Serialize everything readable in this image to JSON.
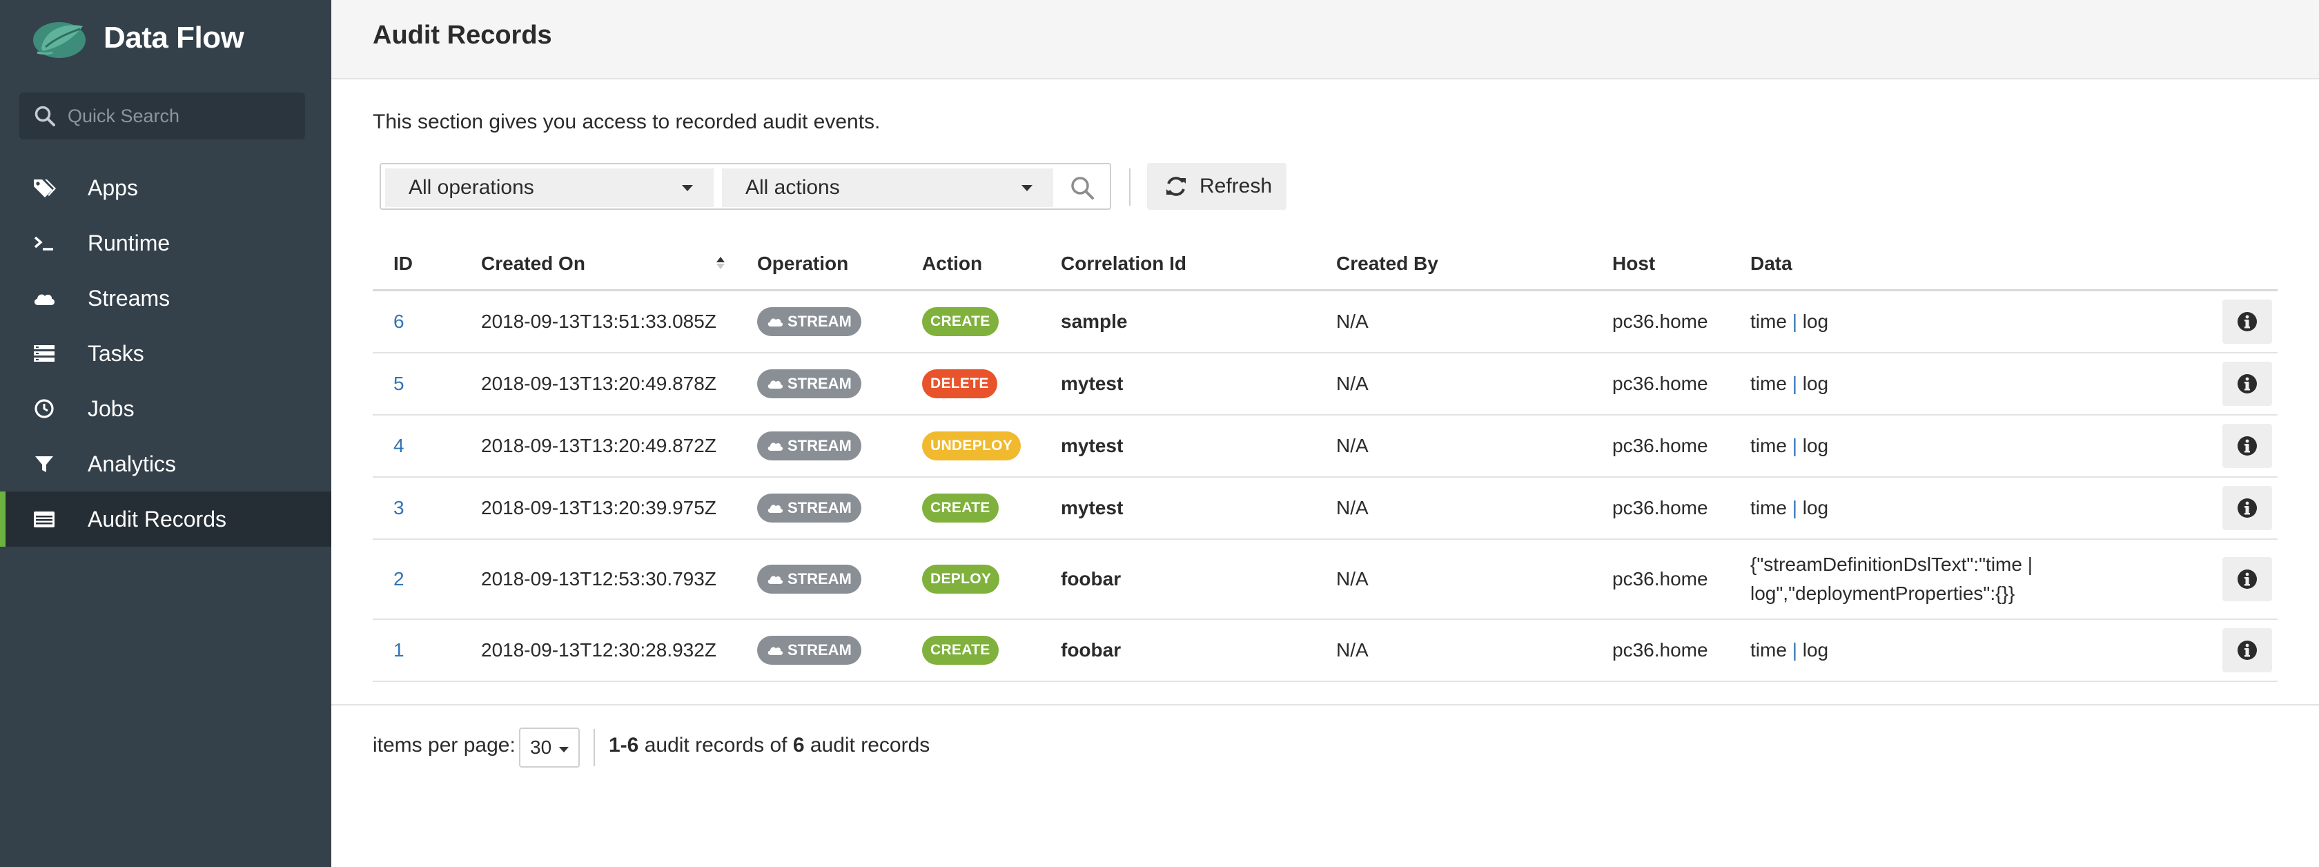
{
  "app": {
    "title": "Data Flow",
    "logo_icon": "spring-leaf-logo"
  },
  "sidebar": {
    "search_placeholder": "Quick Search",
    "items": [
      {
        "label": "Apps",
        "icon": "tags-icon",
        "active": false
      },
      {
        "label": "Runtime",
        "icon": "terminal-icon",
        "active": false
      },
      {
        "label": "Streams",
        "icon": "cloud-icon",
        "active": false
      },
      {
        "label": "Tasks",
        "icon": "tasks-list-icon",
        "active": false
      },
      {
        "label": "Jobs",
        "icon": "clock-icon",
        "active": false
      },
      {
        "label": "Analytics",
        "icon": "filter-icon",
        "active": false
      },
      {
        "label": "Audit Records",
        "icon": "audit-table-icon",
        "active": true
      }
    ]
  },
  "header": {
    "title": "Audit Records"
  },
  "intro": "This section gives you access to recorded audit events.",
  "filters": {
    "operations_value": "All operations",
    "actions_value": "All actions",
    "refresh_label": "Refresh"
  },
  "table": {
    "columns": [
      "ID",
      "Created On",
      "Operation",
      "Action",
      "Correlation Id",
      "Created By",
      "Host",
      "Data"
    ],
    "rows": [
      {
        "id": "6",
        "created_on": "2018-09-13T13:51:33.085Z",
        "operation": "STREAM",
        "action": "CREATE",
        "correlation_id": "sample",
        "created_by": "N/A",
        "host": "pc36.home",
        "data_a": "time",
        "data_sep": "|",
        "data_b": "log",
        "data_full": ""
      },
      {
        "id": "5",
        "created_on": "2018-09-13T13:20:49.878Z",
        "operation": "STREAM",
        "action": "DELETE",
        "correlation_id": "mytest",
        "created_by": "N/A",
        "host": "pc36.home",
        "data_a": "time",
        "data_sep": "|",
        "data_b": "log",
        "data_full": ""
      },
      {
        "id": "4",
        "created_on": "2018-09-13T13:20:49.872Z",
        "operation": "STREAM",
        "action": "UNDEPLOY",
        "correlation_id": "mytest",
        "created_by": "N/A",
        "host": "pc36.home",
        "data_a": "time",
        "data_sep": "|",
        "data_b": "log",
        "data_full": ""
      },
      {
        "id": "3",
        "created_on": "2018-09-13T13:20:39.975Z",
        "operation": "STREAM",
        "action": "CREATE",
        "correlation_id": "mytest",
        "created_by": "N/A",
        "host": "pc36.home",
        "data_a": "time",
        "data_sep": "|",
        "data_b": "log",
        "data_full": ""
      },
      {
        "id": "2",
        "created_on": "2018-09-13T12:53:30.793Z",
        "operation": "STREAM",
        "action": "DEPLOY",
        "correlation_id": "foobar",
        "created_by": "N/A",
        "host": "pc36.home",
        "data_a": "",
        "data_sep": "",
        "data_b": "",
        "data_full": "{\"streamDefinitionDslText\":\"time | log\",\"deploymentProperties\":{}}"
      },
      {
        "id": "1",
        "created_on": "2018-09-13T12:30:28.932Z",
        "operation": "STREAM",
        "action": "CREATE",
        "correlation_id": "foobar",
        "created_by": "N/A",
        "host": "pc36.home",
        "data_a": "time",
        "data_sep": "|",
        "data_b": "log",
        "data_full": ""
      }
    ]
  },
  "action_colors": {
    "CREATE": "#7fb13c",
    "DELETE": "#e8532b",
    "UNDEPLOY": "#f0b92e",
    "DEPLOY": "#7fb13c"
  },
  "footer": {
    "items_per_page_label": "items per page:",
    "items_per_page_value": "30",
    "range": "1-6",
    "range_text": " audit records of ",
    "total": "6",
    "total_text": " audit records"
  }
}
